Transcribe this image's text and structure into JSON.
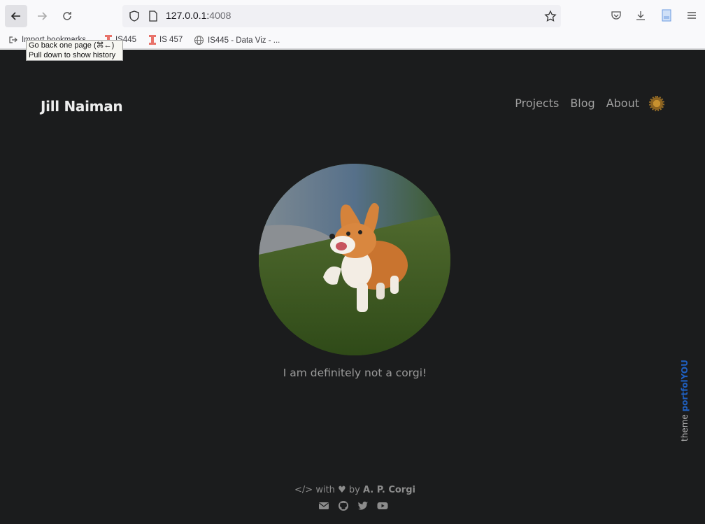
{
  "browser": {
    "url_host": "127.0.0.1:",
    "url_port": "4008",
    "tooltip_line1": "Go back one page (⌘←)",
    "tooltip_line2": "Pull down to show history",
    "bookmarks": [
      {
        "label": "Import bookmarks...",
        "icon": "import-icon"
      },
      {
        "label": "IS445",
        "icon": "illinois-icon"
      },
      {
        "label": "IS 457",
        "icon": "illinois-icon"
      },
      {
        "label": "IS445 - Data Viz - ...",
        "icon": "globe-icon"
      }
    ]
  },
  "site": {
    "title": "Jill Naiman",
    "nav": [
      "Projects",
      "Blog",
      "About"
    ],
    "theme_toggle_icon": "sun-icon",
    "avatar_alt": "corgi photo",
    "caption": "I am definitely not a corgi!",
    "theme_credit_prefix": "theme ",
    "theme_credit_brand": "portfolYOU"
  },
  "footer": {
    "with": "with",
    "by": "by",
    "author": "A. P. Corgi",
    "social_icons": [
      "envelope-icon",
      "github-icon",
      "twitter-icon",
      "youtube-icon"
    ]
  },
  "colors": {
    "page_bg": "#1b1c1d",
    "brand_blue": "#1f5fbf"
  }
}
